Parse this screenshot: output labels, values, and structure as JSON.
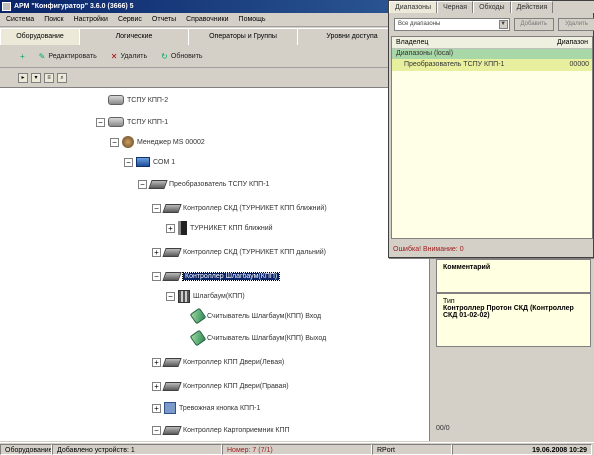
{
  "window": {
    "title": "АРМ \"Конфигуратор\" 3.6.0 (3666) 5"
  },
  "menu": [
    "Система",
    "Поиск",
    "Настройки",
    "Сервис",
    "Отчеты",
    "Справочники",
    "Помощь"
  ],
  "tabs": [
    {
      "label": "Оборудование",
      "active": true
    },
    {
      "label": "Логические",
      "active": false
    },
    {
      "label": "Операторы и Группы",
      "active": false
    },
    {
      "label": "Уровни доступа",
      "active": false
    }
  ],
  "toolbar": {
    "edit_label": "Редактировать",
    "delete_label": "Удалить",
    "refresh_label": "Обновить"
  },
  "tree": {
    "nodes": [
      {
        "label": "ТСПУ КПП-2",
        "icon": "server-icon",
        "expander": ""
      },
      {
        "label": "ТСПУ КПП-1",
        "icon": "server-icon",
        "expander": "−"
      },
      {
        "label": "Менеджер МS 00002",
        "icon": "manager-icon",
        "expander": "−",
        "badge": "MS"
      },
      {
        "label": "COM 1",
        "icon": "com-port-icon",
        "expander": "−",
        "badge": "COM"
      },
      {
        "label": "Преобразователь ТСПУ КПП-1",
        "icon": "converter-icon",
        "expander": "−"
      },
      {
        "label": "Контроллер СКД (ТУРНИКЕТ КПП ближний)",
        "icon": "controller-icon",
        "expander": "−"
      },
      {
        "label": "ТУРНИКЕТ КПП ближний",
        "icon": "turnstile-icon",
        "expander": "+"
      },
      {
        "label": "Контроллер СКД (ТУРНИКЕТ КПП дальний)",
        "icon": "controller-icon",
        "expander": "+"
      },
      {
        "label": "Контроллер Шлагбаум(КПП)",
        "icon": "controller-icon",
        "expander": "−",
        "selected": true
      },
      {
        "label": "Шлагбаум(КПП)",
        "icon": "barrier-icon",
        "expander": "−"
      },
      {
        "label": "Считыватель Шлагбаум(КПП) Вход",
        "icon": "reader-icon",
        "expander": ""
      },
      {
        "label": "Считыватель Шлагбаум(КПП) Выход",
        "icon": "reader-icon",
        "expander": ""
      },
      {
        "label": "Контроллер КПП Двери(Левая)",
        "icon": "controller-icon",
        "expander": "+"
      },
      {
        "label": "Контроллер КПП Двери(Правая)",
        "icon": "controller-icon",
        "expander": "+"
      },
      {
        "label": "Тревожная кнопка КПП-1",
        "icon": "panel-icon",
        "expander": "+"
      },
      {
        "label": "Контроллер Картоприемник КПП",
        "icon": "controller-icon",
        "expander": "−"
      }
    ]
  },
  "info": {
    "comment_label": "Комментарий",
    "type_label": "Тип",
    "type_value": "Контроллер Протон СКД (Контроллер СКД 01-02-02)"
  },
  "dialog": {
    "tabs": [
      {
        "label": "Диапазоны",
        "active": true
      },
      {
        "label": "Черная",
        "active": false
      },
      {
        "label": "Обходы",
        "active": false
      },
      {
        "label": "Действия",
        "active": false
      }
    ],
    "select_value": "Все диапазоны",
    "add_button": "Добавить",
    "delete_button": "Удалить",
    "columns": [
      "Владелец",
      "Диапазон"
    ],
    "group_row": "Диапазоны (local)",
    "item_row": {
      "name": "Преобразователь ТСПУ КПП-1",
      "value": "00000"
    },
    "status": "Ошибка! Внимание: 0"
  },
  "right_footer": "00/0",
  "statusbar": {
    "left": "Оборудование",
    "devices": "Добавлено устройств: 1",
    "number": "Номер: 7 (7/1)",
    "port": "RPort",
    "datetime": "19.06.2008 10:29"
  }
}
